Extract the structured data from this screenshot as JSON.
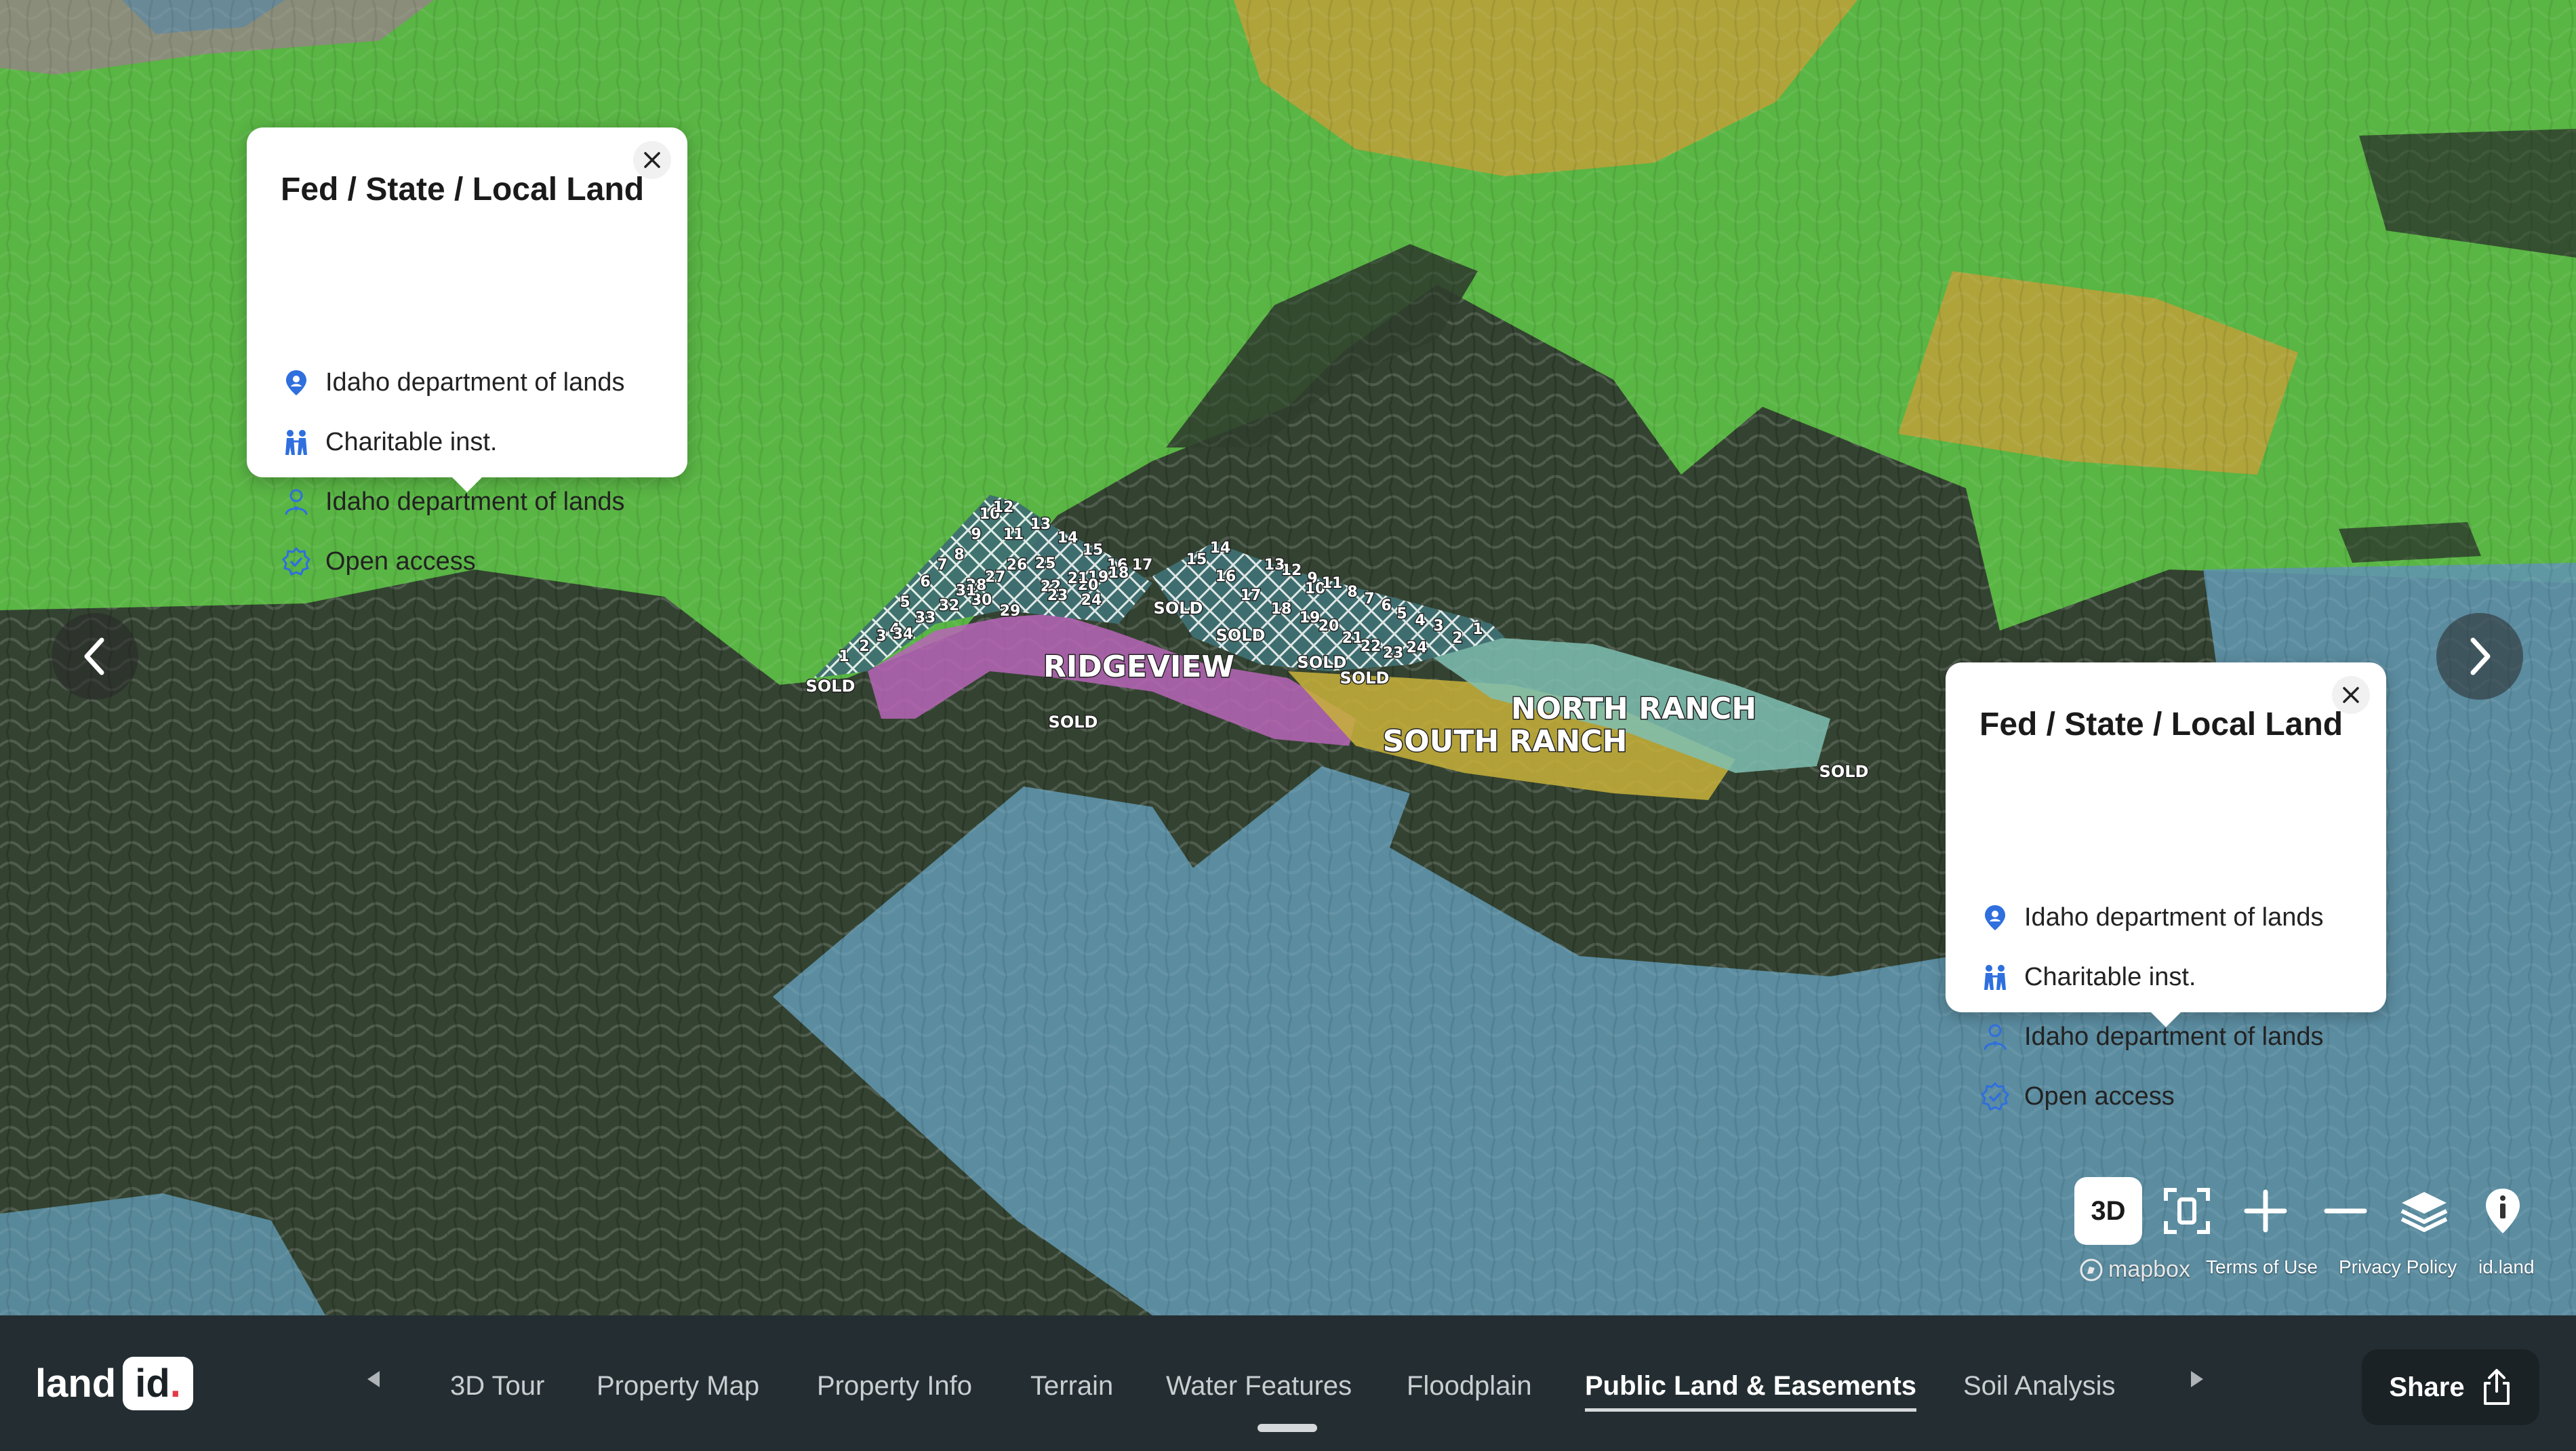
{
  "map": {
    "labels": {
      "ridgeview": "RIDGEVIEW",
      "north_ranch": "NORTH RANCH",
      "south_ranch": "SOUTH RANCH",
      "sold": "SOLD"
    },
    "lot_numbers": [
      "1",
      "2",
      "3",
      "4",
      "5",
      "6",
      "7",
      "8",
      "9",
      "10",
      "11",
      "12",
      "13",
      "14",
      "15",
      "16",
      "17",
      "18",
      "19",
      "20",
      "21",
      "22",
      "23",
      "24",
      "25",
      "26",
      "27",
      "28",
      "29",
      "30",
      "31",
      "32",
      "33",
      "34"
    ],
    "colors": {
      "public_land_green": "#5cbf45",
      "water_blue": "#5f95ad",
      "ridgeview_pink": "#b865b8",
      "south_ranch_yellow": "#c9b23a",
      "north_ranch_teal": "#7fbfb3",
      "forest": "#344331"
    }
  },
  "popups": [
    {
      "title": "Fed / State / Local Land",
      "rows": [
        {
          "icon": "location-person-icon",
          "text": "Idaho department of lands"
        },
        {
          "icon": "charity-hands-icon",
          "text": "Charitable inst."
        },
        {
          "icon": "manager-person-icon",
          "text": "Idaho department of lands"
        },
        {
          "icon": "verified-badge-icon",
          "text": "Open access"
        }
      ]
    },
    {
      "title": "Fed / State / Local Land",
      "rows": [
        {
          "icon": "location-person-icon",
          "text": "Idaho department of lands"
        },
        {
          "icon": "charity-hands-icon",
          "text": "Charitable inst."
        },
        {
          "icon": "manager-person-icon",
          "text": "Idaho department of lands"
        },
        {
          "icon": "verified-badge-icon",
          "text": "Open access"
        }
      ]
    }
  ],
  "controls": {
    "three_d": "3D",
    "icons": [
      "fullscreen-icon",
      "plus-icon",
      "minus-icon",
      "layers-icon",
      "info-icon"
    ]
  },
  "attribution": {
    "mapbox": "mapbox",
    "terms": "Terms of Use",
    "privacy": "Privacy Policy",
    "idland": "id.land"
  },
  "bottom_bar": {
    "logo_land": "land",
    "logo_id": "id",
    "tabs": [
      "3D Tour",
      "Property Map",
      "Property Info",
      "Terrain",
      "Water Features",
      "Floodplain",
      "Public Land & Easements",
      "Soil Analysis"
    ],
    "active_tab": "Public Land & Easements",
    "share": "Share"
  }
}
